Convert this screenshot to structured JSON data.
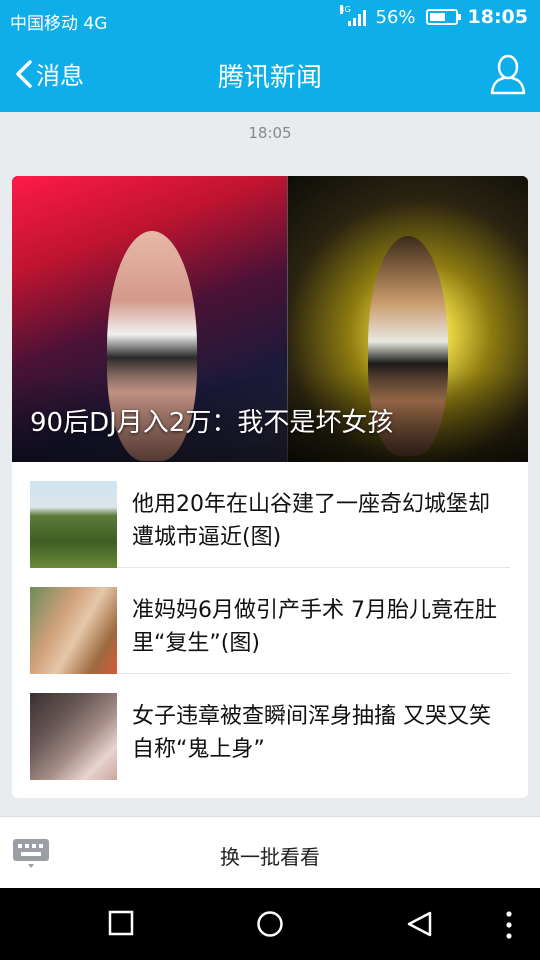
{
  "status_bar": {
    "carrier": "中国移动 4G",
    "network_badge": "4G",
    "battery_percent": "56%",
    "battery_level": 0.56,
    "time": "18:05"
  },
  "nav": {
    "back_label": "消息",
    "title": "腾讯新闻",
    "profile_icon": "user-icon"
  },
  "timestamp": "18:05",
  "card": {
    "headline": "90后DJ月入2万：我不是坏女孩",
    "items": [
      {
        "title": "他用20年在山谷建了一座奇幻城堡却遭城市逼近(图)"
      },
      {
        "title": "准妈妈6月做引产手术 7月胎儿竟在肚里“复生”(图)"
      },
      {
        "title": "女子违章被查瞬间浑身抽搐 又哭又笑自称“鬼上身”"
      }
    ]
  },
  "bottom": {
    "keyboard_icon": "keyboard-icon",
    "more_label": "换一批看看"
  },
  "system_nav": [
    "square-icon",
    "circle-icon",
    "back-triangle-icon",
    "more-dots-icon"
  ],
  "colors": {
    "accent": "#0daee9",
    "background": "#e9ecef"
  }
}
